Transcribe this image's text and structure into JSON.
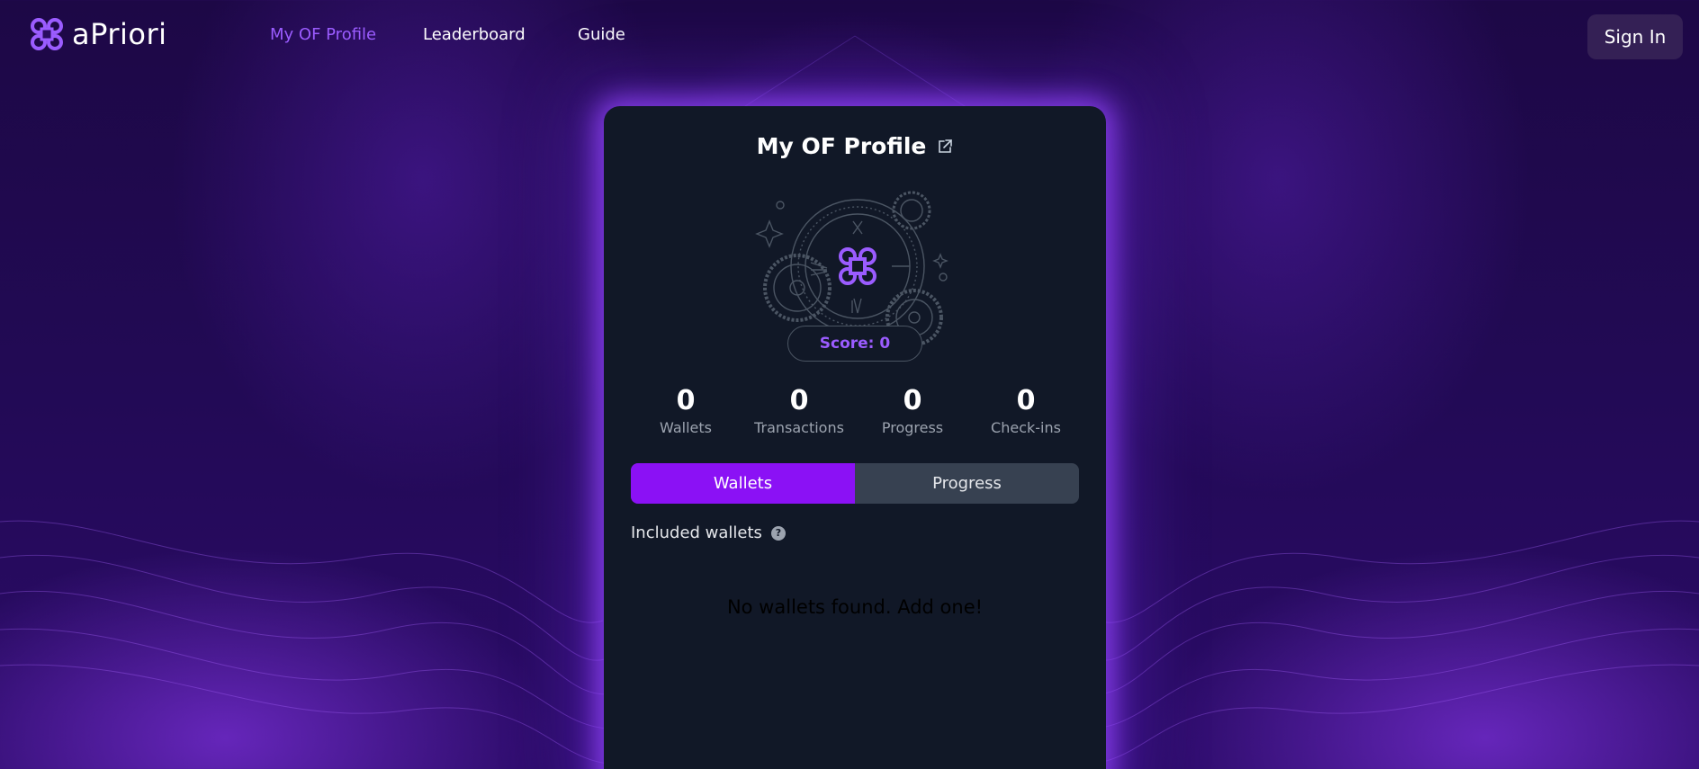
{
  "colors": {
    "accent": "#9b5cff",
    "tab_active": "#8b11f5",
    "card_bg": "#111827",
    "page_bg": "#220a55"
  },
  "nav": {
    "brand": "aPriori",
    "links": [
      "My OF Profile",
      "Leaderboard",
      "Guide"
    ],
    "active_link": "My OF Profile",
    "signin_label": "Sign In"
  },
  "card": {
    "title": "My OF Profile",
    "score_label": "Score: 0",
    "stats": [
      {
        "value": "0",
        "label": "Wallets"
      },
      {
        "value": "0",
        "label": "Transactions"
      },
      {
        "value": "0",
        "label": "Progress"
      },
      {
        "value": "0",
        "label": "Check-ins"
      }
    ],
    "tabs": [
      "Wallets",
      "Progress"
    ],
    "active_tab": "Wallets",
    "included_label": "Included wallets",
    "help_glyph": "?",
    "empty_message": "No wallets found. Add one!"
  },
  "icons": [
    "apriori-logo-icon",
    "external-link-icon",
    "gear-clock-emblem-icon",
    "help-icon"
  ]
}
